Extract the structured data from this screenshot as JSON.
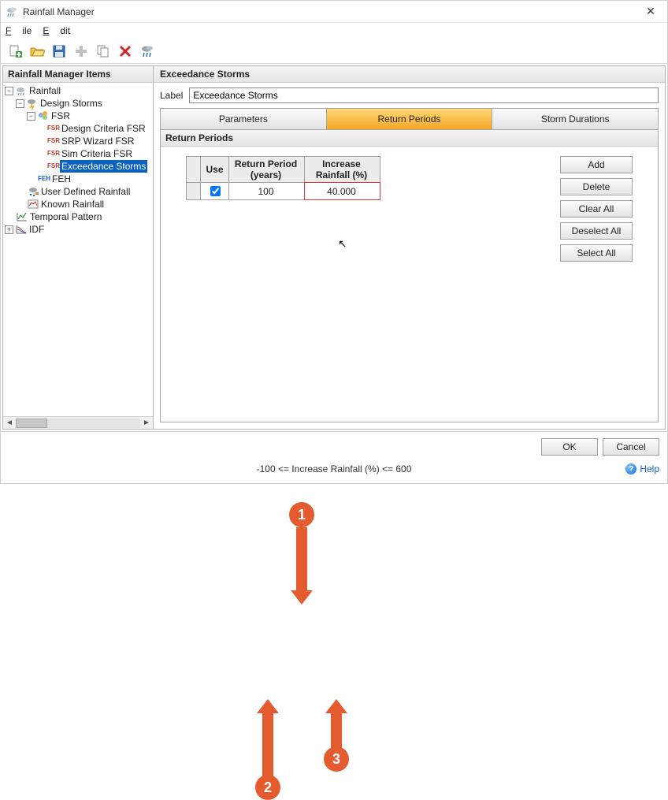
{
  "window": {
    "title": "Rainfall Manager"
  },
  "menu": {
    "file": "File",
    "edit": "Edit"
  },
  "sidebar": {
    "header": "Rainfall Manager Items",
    "nodes": {
      "rainfall": "Rainfall",
      "design_storms": "Design Storms",
      "fsr": "FSR",
      "design_criteria_fsr": "Design Criteria FSR",
      "srp_wizard_fsr": "SRP Wizard FSR",
      "sim_criteria_fsr": "Sim Criteria FSR",
      "exceedance_storms": "Exceedance Storms",
      "feh": "FEH",
      "user_defined": "User Defined Rainfall",
      "known_rainfall": "Known Rainfall",
      "temporal_pattern": "Temporal Pattern",
      "idf": "IDF"
    }
  },
  "main": {
    "header": "Exceedance Storms",
    "label_caption": "Label",
    "label_value": "Exceedance Storms",
    "tabs": {
      "parameters": "Parameters",
      "return_periods": "Return Periods",
      "storm_durations": "Storm Durations"
    },
    "panel_header": "Return Periods",
    "grid": {
      "col_use": "Use",
      "col_rp": "Return Period (years)",
      "col_inc": "Increase Rainfall (%)",
      "rows": [
        {
          "use": true,
          "return_period": "100",
          "increase": "40.000"
        }
      ]
    },
    "buttons": {
      "add": "Add",
      "delete": "Delete",
      "clear_all": "Clear All",
      "deselect_all": "Deselect All",
      "select_all": "Select All"
    }
  },
  "footer": {
    "ok": "OK",
    "cancel": "Cancel",
    "status": "-100 <= Increase Rainfall (%) <= 600",
    "help": "Help"
  },
  "annotations": {
    "b1": "1",
    "b2": "2",
    "b3": "3"
  },
  "colors": {
    "accent": "#e35b2e",
    "active_tab_top": "#ffd873",
    "active_tab_bottom": "#f5a728",
    "selection": "#0a63c2"
  }
}
